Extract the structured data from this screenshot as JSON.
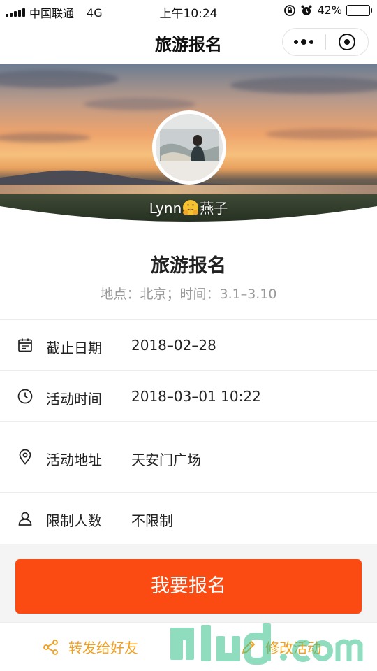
{
  "status_bar": {
    "carrier": "中国联通",
    "network": "4G",
    "time": "上午10:24",
    "battery": "42%",
    "battery_level": 0.42
  },
  "nav": {
    "title": "旅游报名"
  },
  "profile": {
    "nickname_prefix": "Lynn",
    "nickname_suffix": "燕子"
  },
  "event": {
    "title": "旅游报名",
    "subtitle": "地点：北京；时间：3.1–3.10"
  },
  "details": [
    {
      "icon": "calendar-icon",
      "label": "截止日期",
      "value": "2018–02–28"
    },
    {
      "icon": "clock-icon",
      "label": "活动时间",
      "value": "2018–03–01 10:22"
    },
    {
      "icon": "location-pin-icon",
      "label": "活动地址",
      "value": "天安门广场"
    },
    {
      "icon": "person-icon",
      "label": "限制人数",
      "value": "不限制"
    }
  ],
  "actions": {
    "signup_label": "我要报名",
    "share_label": "转发给好友",
    "edit_label": "修改活动"
  },
  "colors": {
    "accent": "#fb4b12",
    "secondary": "#f0a020"
  }
}
